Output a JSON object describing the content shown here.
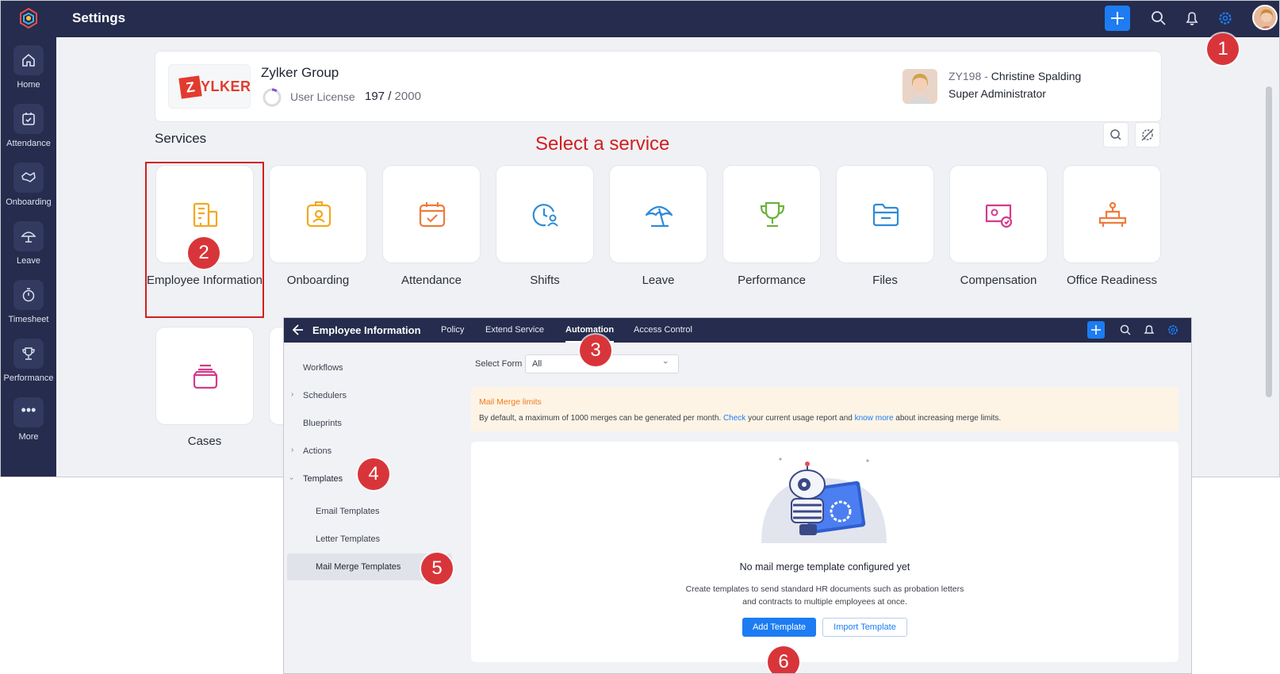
{
  "app": {
    "title": "Settings",
    "nav": [
      {
        "label": "Home",
        "icon": "home-icon"
      },
      {
        "label": "Attendance",
        "icon": "calendar-check-icon"
      },
      {
        "label": "Onboarding",
        "icon": "handshake-icon"
      },
      {
        "label": "Leave",
        "icon": "umbrella-icon"
      },
      {
        "label": "Timesheet",
        "icon": "stopwatch-icon"
      },
      {
        "label": "Performance",
        "icon": "trophy-icon"
      },
      {
        "label": "More",
        "icon": "more-dots-icon"
      }
    ],
    "accent": "#1d7cf2",
    "nav_bg": "#252c4d"
  },
  "org": {
    "name": "Zylker Group",
    "logo_z": "Z",
    "logo_rest": "YLKER",
    "license_label": "User License",
    "license_used": "197",
    "license_sep": " / ",
    "license_total": "2000",
    "license_fraction": 0.0985,
    "user_id": "ZY198",
    "user_sep": " - ",
    "user_name": "Christine Spalding",
    "user_role": "Super Administrator"
  },
  "services": {
    "heading": "Services",
    "annotation": "Select a service",
    "items": [
      {
        "label": "Employee Information",
        "icon": "building-icon",
        "color": "#f2a81d"
      },
      {
        "label": "Onboarding",
        "icon": "badge-icon",
        "color": "#f2a81d"
      },
      {
        "label": "Attendance",
        "icon": "calendar-icon",
        "color": "#f07a3a"
      },
      {
        "label": "Shifts",
        "icon": "clock-user-icon",
        "color": "#2e8bd8"
      },
      {
        "label": "Leave",
        "icon": "umbrella-icon",
        "color": "#2e8bd8"
      },
      {
        "label": "Performance",
        "icon": "trophy-icon",
        "color": "#6bb33a"
      },
      {
        "label": "Files",
        "icon": "folder-icon",
        "color": "#2e8bd8"
      },
      {
        "label": "Compensation",
        "icon": "money-icon",
        "color": "#d43a8c"
      },
      {
        "label": "Office Readiness",
        "icon": "desk-icon",
        "color": "#f07a3a"
      },
      {
        "label": "Cases",
        "icon": "inbox-tray-icon",
        "color": "#d43a8c"
      }
    ]
  },
  "steps": [
    "1",
    "2",
    "3",
    "4",
    "5",
    "6"
  ],
  "inset": {
    "title": "Employee Information",
    "tabs": [
      "Policy",
      "Extend Service",
      "Automation",
      "Access Control"
    ],
    "active_tab": "Automation",
    "sidebar": {
      "workflows": "Workflows",
      "schedulers": "Schedulers",
      "blueprints": "Blueprints",
      "actions": "Actions",
      "templates": "Templates",
      "email_templates": "Email Templates",
      "letter_templates": "Letter Templates",
      "mail_merge_templates": "Mail Merge Templates"
    },
    "select_form_label": "Select Form",
    "select_form_value": "All",
    "banner_title": "Mail Merge limits",
    "banner_text_1": "By default, a maximum of 1000 merges can be generated per month. ",
    "banner_link_1": "Check",
    "banner_text_2": " your current usage report and ",
    "banner_link_2": "know more",
    "banner_text_3": " about increasing merge limits.",
    "empty_title": "No mail merge template configured yet",
    "empty_desc_1": "Create templates to send standard HR documents such as probation letters",
    "empty_desc_2": "and contracts to multiple employees at once.",
    "add_button": "Add Template",
    "import_button": "Import Template"
  }
}
